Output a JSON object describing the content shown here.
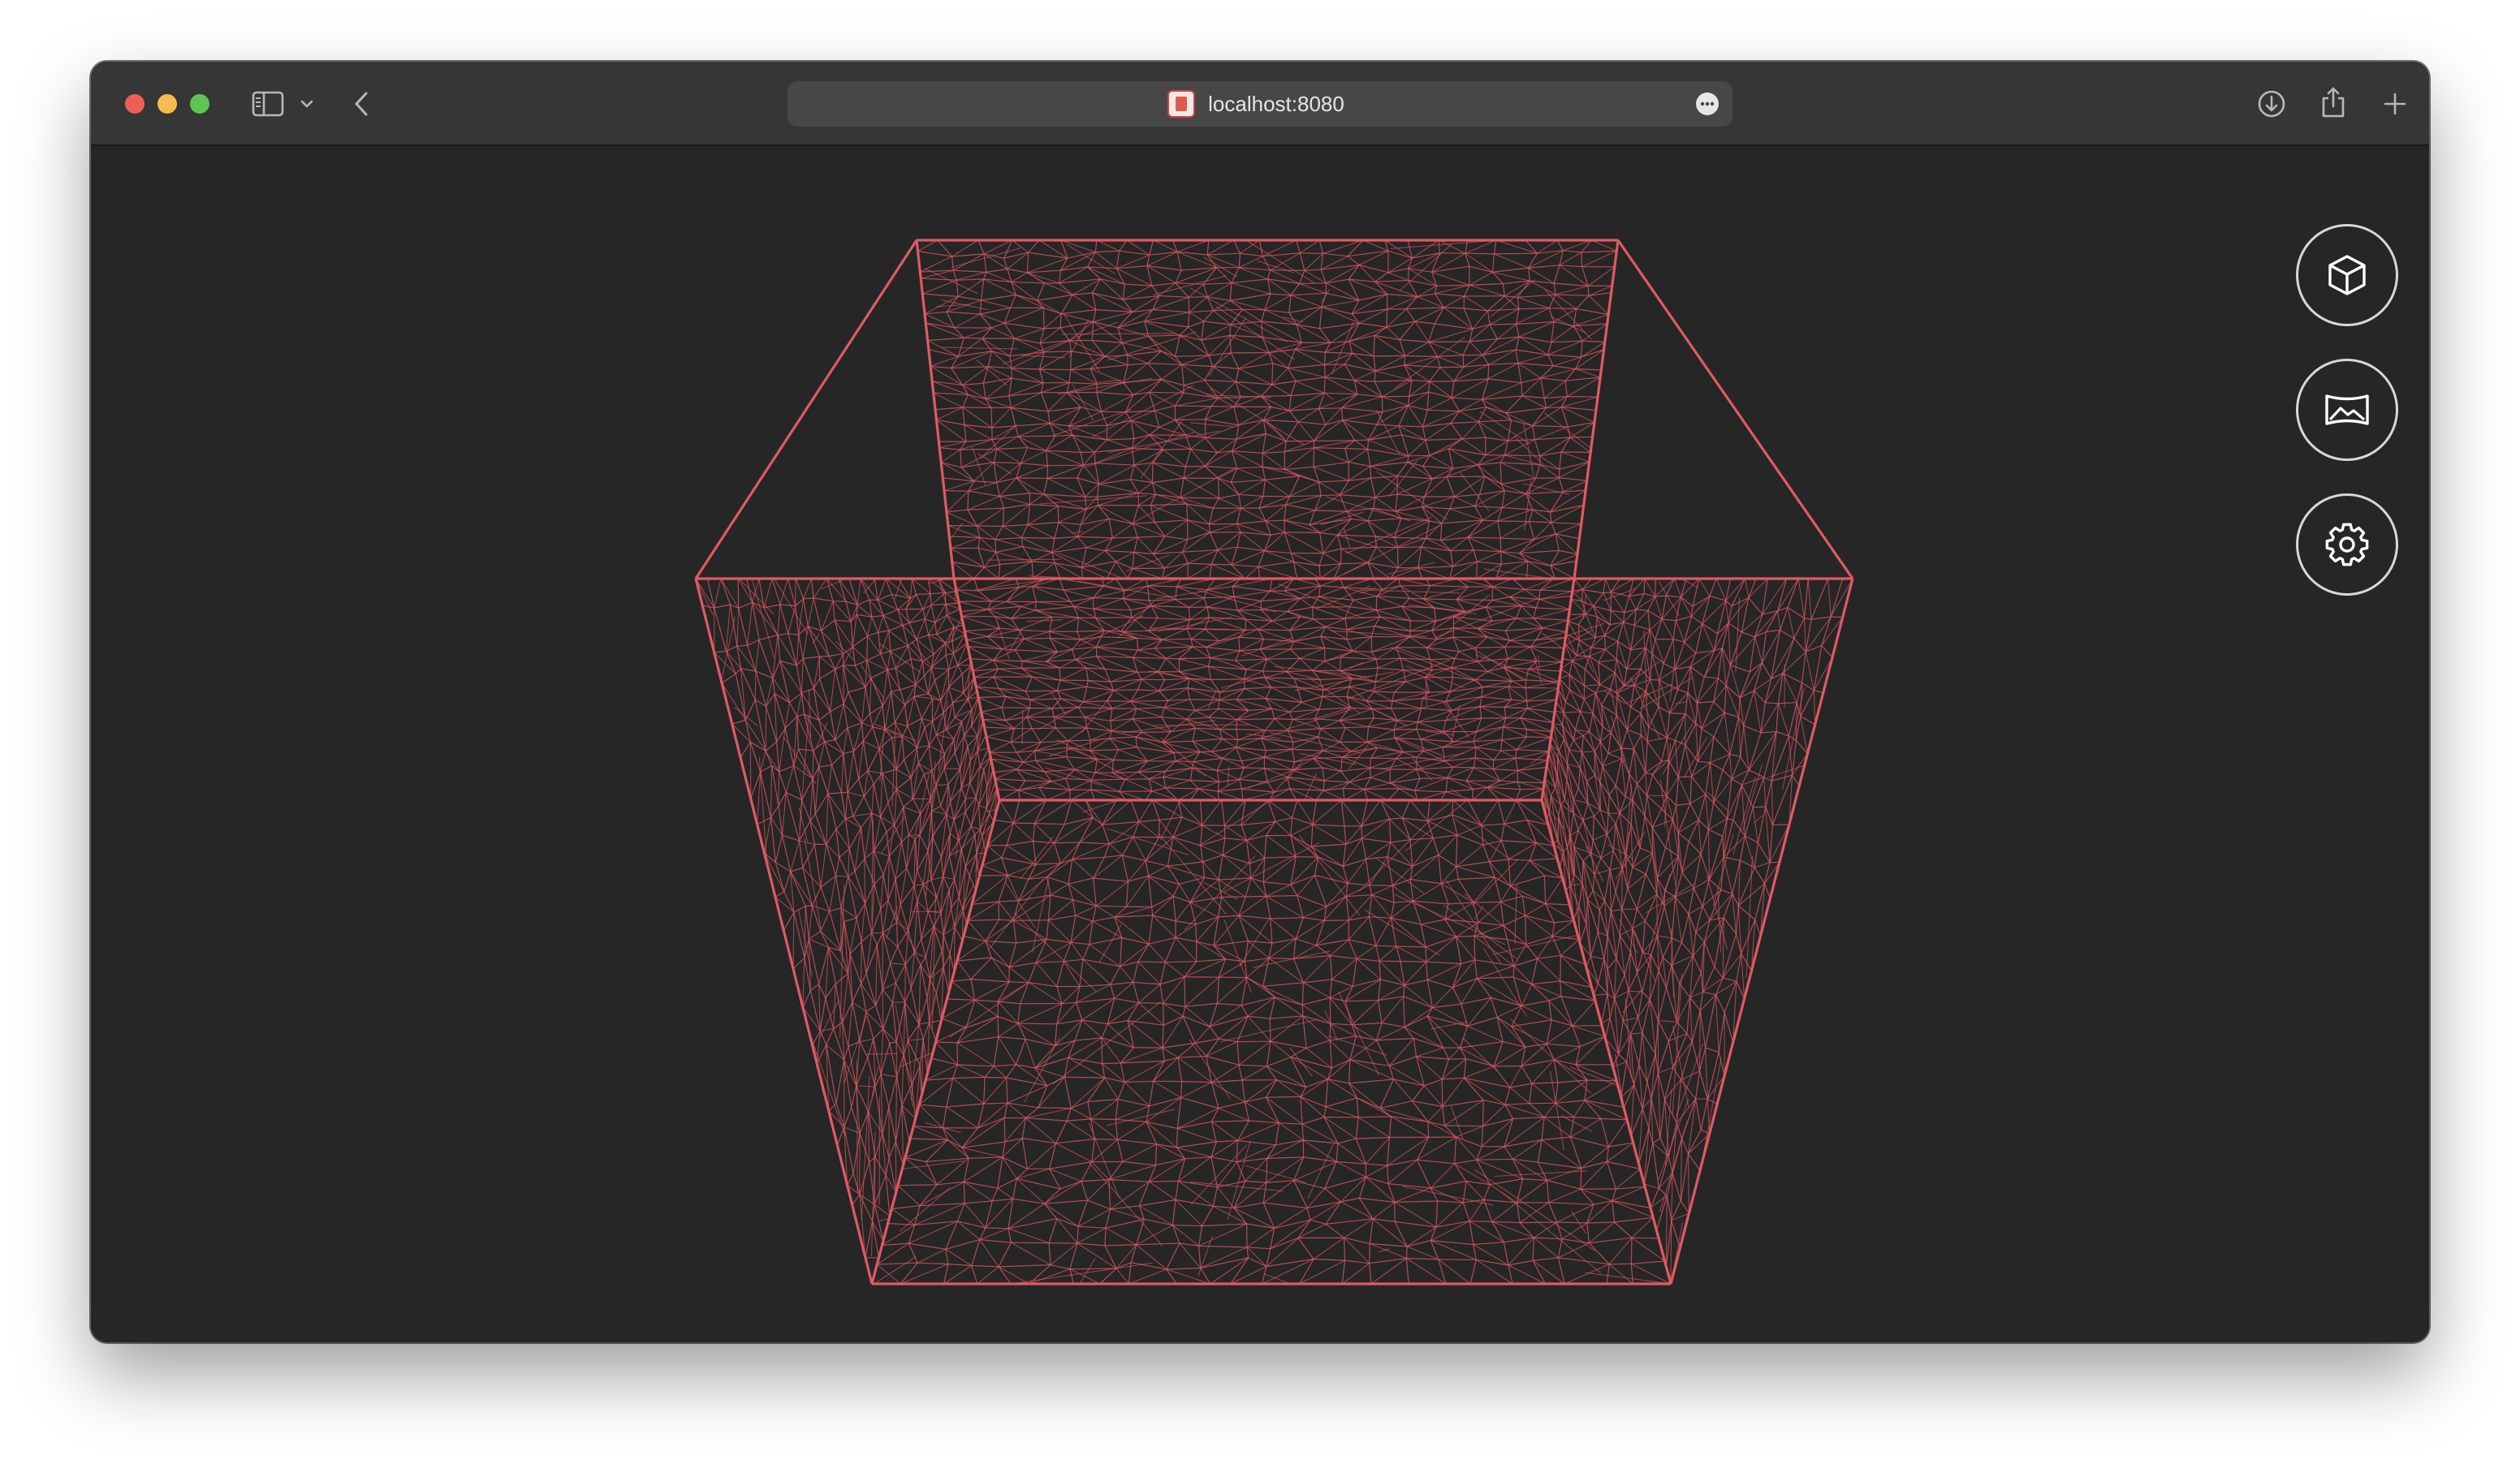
{
  "browser": {
    "url": "localhost:8080",
    "icons": {
      "close": "traffic-light-close",
      "minimize": "traffic-light-minimize",
      "zoom": "traffic-light-zoom",
      "sidebar": "sidebar-icon",
      "sidebar_menu": "chevron-down-icon",
      "back": "chevron-left-icon",
      "site": "favicon-icon",
      "page_menu": "more-icon",
      "downloads": "download-icon",
      "share": "share-icon",
      "new_tab": "plus-icon"
    }
  },
  "viewer": {
    "object": "wireframe-cube",
    "wire_color": "#e05a63",
    "background": "#262626"
  },
  "controls": [
    {
      "name": "model-button",
      "icon": "cube-icon"
    },
    {
      "name": "environment-button",
      "icon": "panorama-image-icon"
    },
    {
      "name": "settings-button",
      "icon": "gear-icon"
    }
  ],
  "colors": {
    "traffic_close": "#ee5f57",
    "traffic_minimize": "#f5bd4f",
    "traffic_zoom": "#5fc454",
    "titlebar": "#363636",
    "urlbar": "#474747"
  }
}
